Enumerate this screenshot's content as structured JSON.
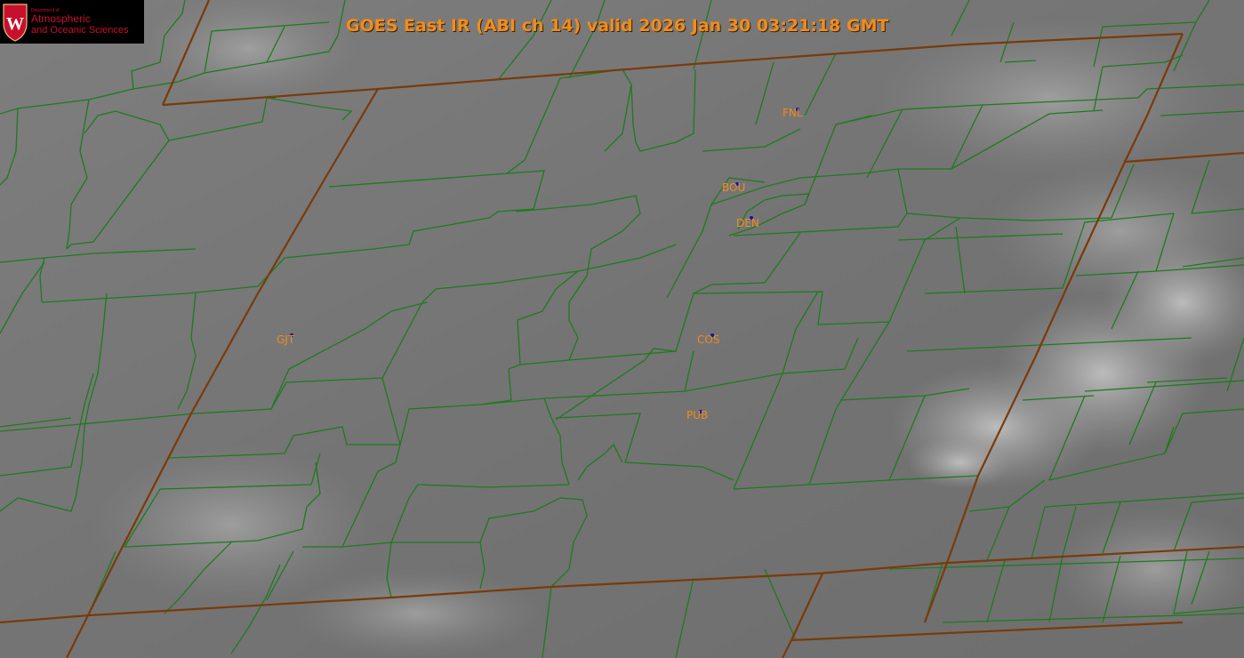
{
  "title": "GOES East IR (ABI ch 14) valid 2026 Jan 30 03:21:18 GMT",
  "logo": {
    "line1": "Department of",
    "line2": "Atmospheric",
    "line3": "and Oceanic Sciences",
    "crest_letter": "W"
  },
  "stations": [
    {
      "id": "FNL",
      "label": "FNL"
    },
    {
      "id": "BOU",
      "label": "BOU"
    },
    {
      "id": "DEN",
      "label": "DEN"
    },
    {
      "id": "GJT",
      "label": "GJT"
    },
    {
      "id": "COS",
      "label": "COS"
    },
    {
      "id": "PUB",
      "label": "PUB"
    }
  ],
  "colors": {
    "county_lines": "#1f7a1f",
    "state_lines": "#7a3a0a",
    "label": "#f28c1a",
    "station_marker": "#1010c0",
    "logo_text": "#c8102e"
  }
}
